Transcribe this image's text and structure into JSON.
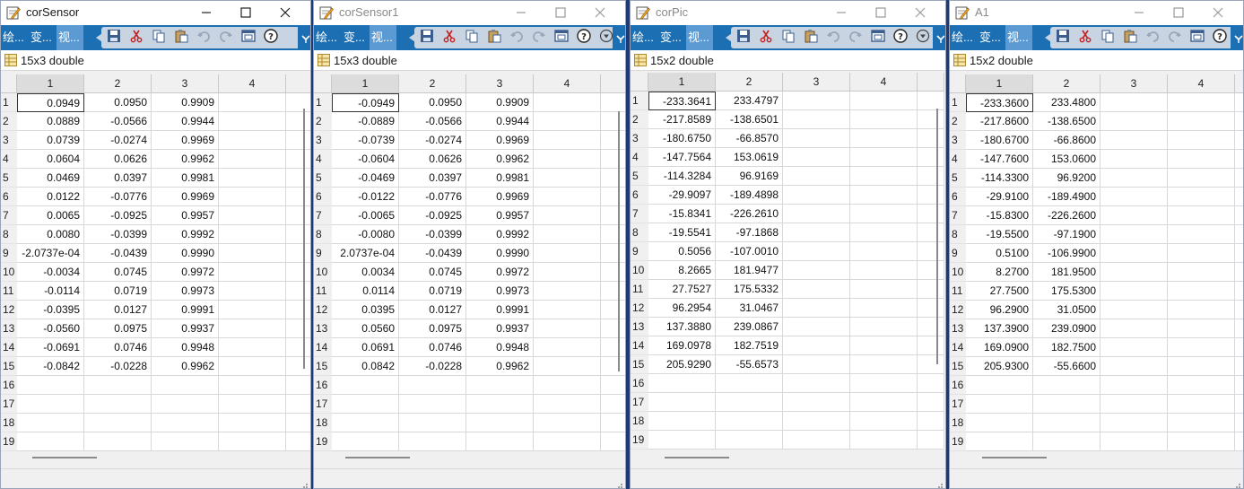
{
  "toolstrip": {
    "tabs": [
      "绘...",
      "变...",
      "视..."
    ],
    "selected_tab": 2,
    "tools": [
      "save-icon",
      "cut-icon",
      "copy-icon",
      "paste-icon",
      "undo-icon",
      "redo-icon",
      "window-icon",
      "help-icon",
      "options-icon"
    ]
  },
  "colors": {
    "toolstrip": "#1d6fb3",
    "tab_selected": "#5b9ad2",
    "desktop": "#1c3a78"
  },
  "windows": [
    {
      "title": "corSensor",
      "active": true,
      "size_label": "15x3 double",
      "col_headers": [
        "1",
        "2",
        "3",
        "4"
      ],
      "rows": [
        [
          "0.0949",
          "0.0950",
          "0.9909"
        ],
        [
          "0.0889",
          "-0.0566",
          "0.9944"
        ],
        [
          "0.0739",
          "-0.0274",
          "0.9969"
        ],
        [
          "0.0604",
          "0.0626",
          "0.9962"
        ],
        [
          "0.0469",
          "0.0397",
          "0.9981"
        ],
        [
          "0.0122",
          "-0.0776",
          "0.9969"
        ],
        [
          "0.0065",
          "-0.0925",
          "0.9957"
        ],
        [
          "0.0080",
          "-0.0399",
          "0.9992"
        ],
        [
          "-2.0737e-04",
          "-0.0439",
          "0.9990"
        ],
        [
          "-0.0034",
          "0.0745",
          "0.9972"
        ],
        [
          "-0.0114",
          "0.0719",
          "0.9973"
        ],
        [
          "-0.0395",
          "0.0127",
          "0.9991"
        ],
        [
          "-0.0560",
          "0.0975",
          "0.9937"
        ],
        [
          "-0.0691",
          "0.0746",
          "0.9948"
        ],
        [
          "-0.0842",
          "-0.0228",
          "0.9962"
        ]
      ],
      "row_headers": [
        "1",
        "2",
        "3",
        "4",
        "5",
        "6",
        "7",
        "8",
        "9",
        "10",
        "11",
        "12",
        "13",
        "14",
        "15",
        "16",
        "17",
        "18",
        "19"
      ]
    },
    {
      "title": "corSensor1",
      "active": false,
      "size_label": "15x3 double",
      "col_headers": [
        "1",
        "2",
        "3",
        "4"
      ],
      "rows": [
        [
          "-0.0949",
          "0.0950",
          "0.9909"
        ],
        [
          "-0.0889",
          "-0.0566",
          "0.9944"
        ],
        [
          "-0.0739",
          "-0.0274",
          "0.9969"
        ],
        [
          "-0.0604",
          "0.0626",
          "0.9962"
        ],
        [
          "-0.0469",
          "0.0397",
          "0.9981"
        ],
        [
          "-0.0122",
          "-0.0776",
          "0.9969"
        ],
        [
          "-0.0065",
          "-0.0925",
          "0.9957"
        ],
        [
          "-0.0080",
          "-0.0399",
          "0.9992"
        ],
        [
          "2.0737e-04",
          "-0.0439",
          "0.9990"
        ],
        [
          "0.0034",
          "0.0745",
          "0.9972"
        ],
        [
          "0.0114",
          "0.0719",
          "0.9973"
        ],
        [
          "0.0395",
          "0.0127",
          "0.9991"
        ],
        [
          "0.0560",
          "0.0975",
          "0.9937"
        ],
        [
          "0.0691",
          "0.0746",
          "0.9948"
        ],
        [
          "0.0842",
          "-0.0228",
          "0.9962"
        ]
      ],
      "row_headers": [
        "1",
        "2",
        "3",
        "4",
        "5",
        "6",
        "7",
        "8",
        "9",
        "10",
        "11",
        "12",
        "13",
        "14",
        "15",
        "16",
        "17",
        "18",
        "19"
      ]
    },
    {
      "title": "corPic",
      "active": false,
      "size_label": "15x2 double",
      "col_headers": [
        "1",
        "2",
        "3",
        "4"
      ],
      "rows": [
        [
          "-233.3641",
          "233.4797"
        ],
        [
          "-217.8589",
          "-138.6501"
        ],
        [
          "-180.6750",
          "-66.8570"
        ],
        [
          "-147.7564",
          "153.0619"
        ],
        [
          "-114.3284",
          "96.9169"
        ],
        [
          "-29.9097",
          "-189.4898"
        ],
        [
          "-15.8341",
          "-226.2610"
        ],
        [
          "-19.5541",
          "-97.1868"
        ],
        [
          "0.5056",
          "-107.0010"
        ],
        [
          "8.2665",
          "181.9477"
        ],
        [
          "27.7527",
          "175.5332"
        ],
        [
          "96.2954",
          "31.0467"
        ],
        [
          "137.3880",
          "239.0867"
        ],
        [
          "169.0978",
          "182.7519"
        ],
        [
          "205.9290",
          "-55.6573"
        ]
      ],
      "row_headers": [
        "1",
        "2",
        "3",
        "4",
        "5",
        "6",
        "7",
        "8",
        "9",
        "10",
        "11",
        "12",
        "13",
        "14",
        "15",
        "16",
        "17",
        "18",
        "19"
      ]
    },
    {
      "title": "A1",
      "active": false,
      "size_label": "15x2 double",
      "col_headers": [
        "1",
        "2",
        "3",
        "4"
      ],
      "rows": [
        [
          "-233.3600",
          "233.4800"
        ],
        [
          "-217.8600",
          "-138.6500"
        ],
        [
          "-180.6700",
          "-66.8600"
        ],
        [
          "-147.7600",
          "153.0600"
        ],
        [
          "-114.3300",
          "96.9200"
        ],
        [
          "-29.9100",
          "-189.4900"
        ],
        [
          "-15.8300",
          "-226.2600"
        ],
        [
          "-19.5500",
          "-97.1900"
        ],
        [
          "0.5100",
          "-106.9900"
        ],
        [
          "8.2700",
          "181.9500"
        ],
        [
          "27.7500",
          "175.5300"
        ],
        [
          "96.2900",
          "31.0500"
        ],
        [
          "137.3900",
          "239.0900"
        ],
        [
          "169.0900",
          "182.7500"
        ],
        [
          "205.9300",
          "-55.6600"
        ]
      ],
      "row_headers": [
        "1",
        "2",
        "3",
        "4",
        "5",
        "6",
        "7",
        "8",
        "9",
        "10",
        "11",
        "12",
        "13",
        "14",
        "15",
        "16",
        "17",
        "18",
        "19"
      ]
    }
  ]
}
